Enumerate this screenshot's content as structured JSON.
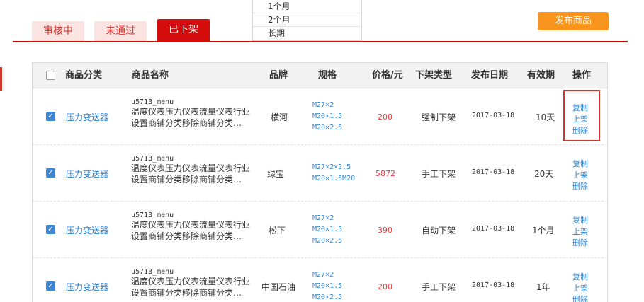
{
  "tabs": [
    {
      "label": "审核中"
    },
    {
      "label": "未通过"
    },
    {
      "label": "已下架"
    }
  ],
  "dropdown": {
    "options": [
      "1个月",
      "2个月",
      "长期"
    ]
  },
  "publish_button": "发布商品",
  "table": {
    "headers": {
      "category": "商品分类",
      "name": "商品名称",
      "brand": "品牌",
      "spec": "规格",
      "price": "价格/元",
      "offtype": "下架类型",
      "date": "发布日期",
      "validity": "有效期",
      "ops": "操作"
    },
    "rows": [
      {
        "category": "压力变送器",
        "code": "u5713_menu",
        "desc1": "温度仪表压力仪表流量仪表行业",
        "desc2": "设置商铺分类移除商铺分类…",
        "brand": "横河",
        "specs": [
          "M27×2",
          "M20×1.5",
          "M20×2.5"
        ],
        "price": "200",
        "offtype": "强制下架",
        "date": "2017-03-18",
        "validity": "10天",
        "ops": [
          "复制",
          "上架",
          "删除"
        ]
      },
      {
        "category": "压力变送器",
        "code": "u5713_menu",
        "desc1": "温度仪表压力仪表流量仪表行业",
        "desc2": "设置商铺分类移除商铺分类…",
        "brand": "绿宝",
        "specs": [
          "M27×2×2.5",
          "M20×1.5M20"
        ],
        "price": "5872",
        "offtype": "手工下架",
        "date": "2017-03-18",
        "validity": "20天",
        "ops": [
          "复制",
          "上架",
          "删除"
        ]
      },
      {
        "category": "压力变送器",
        "code": "u5713_menu",
        "desc1": "温度仪表压力仪表流量仪表行业",
        "desc2": "设置商铺分类移除商铺分类…",
        "brand": "松下",
        "specs": [
          "M27×2",
          "M20×1.5",
          "M20×2.5"
        ],
        "price": "390",
        "offtype": "自动下架",
        "date": "2017-03-18",
        "validity": "1个月",
        "ops": [
          "复制",
          "上架",
          "删除"
        ]
      },
      {
        "category": "压力变送器",
        "code": "u5713_menu",
        "desc1": "温度仪表压力仪表流量仪表行业",
        "desc2": "设置商铺分类移除商铺分类…",
        "brand": "中国石油",
        "specs": [
          "M27×2",
          "M20×1.5",
          "M20×2.5"
        ],
        "price": "200",
        "offtype": "手工下架",
        "date": "2017-03-18",
        "validity": "1年",
        "ops": [
          "复制",
          "上架",
          "删除"
        ]
      }
    ]
  }
}
